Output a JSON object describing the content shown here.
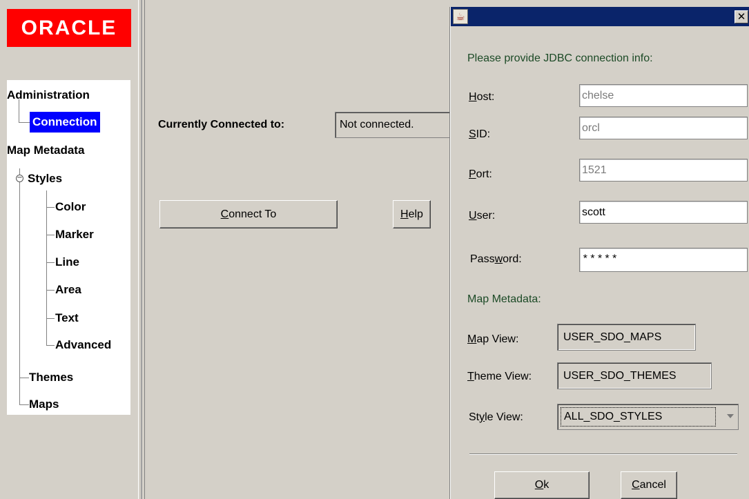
{
  "left": {
    "logo_text": "ORACLE",
    "logo_color": "#ff0000",
    "tree": [
      {
        "label": "Administration"
      },
      {
        "label": "Connection",
        "selected": true
      },
      {
        "label": "Map Metadata"
      },
      {
        "label": "Styles",
        "expanded": true
      },
      {
        "label": "Color"
      },
      {
        "label": "Marker"
      },
      {
        "label": "Line"
      },
      {
        "label": "Area"
      },
      {
        "label": "Text"
      },
      {
        "label": "Advanced"
      },
      {
        "label": "Themes"
      },
      {
        "label": "Maps"
      }
    ]
  },
  "center": {
    "connected_label": "Currently Connected to:",
    "status_value": "Not connected.",
    "connect_button": {
      "mnemonic": "C",
      "rest": "onnect To"
    },
    "help_button": {
      "mnemonic": "H",
      "rest": "elp"
    }
  },
  "dialog": {
    "close_glyph": "✕",
    "instruction": "Please provide JDBC connection info:",
    "host": {
      "label_mn": "H",
      "label_rest": "ost:",
      "value": "chelse"
    },
    "sid": {
      "label_mn": "S",
      "label_rest": "ID:",
      "value": "orcl"
    },
    "port": {
      "label_mn": "P",
      "label_rest": "ort:",
      "value": "1521"
    },
    "user": {
      "label_mn": "U",
      "label_rest": "ser:",
      "value": "scott"
    },
    "password": {
      "label_pre": "Pass",
      "label_mn": "w",
      "label_rest": "ord:",
      "value": "*****"
    },
    "map_metadata_heading": "Map Metadata:",
    "map_view": {
      "label_mn": "M",
      "label_rest": "ap View:",
      "value": "USER_SDO_MAPS"
    },
    "theme_view": {
      "label_mn": "T",
      "label_rest": "heme View:",
      "value": "USER_SDO_THEMES"
    },
    "style_view": {
      "label_pre": "St",
      "label_mn": "y",
      "label_rest": "le View:",
      "value": "ALL_SDO_STYLES"
    },
    "ok_button": {
      "mnemonic": "O",
      "rest": "k"
    },
    "cancel_button": {
      "mnemonic": "C",
      "rest": "ancel"
    }
  },
  "colors": {
    "title_bar": "#0a246a",
    "selection": "#0000ff",
    "window_bg": "#d4d0c8",
    "heading_text": "#1c4a26"
  }
}
